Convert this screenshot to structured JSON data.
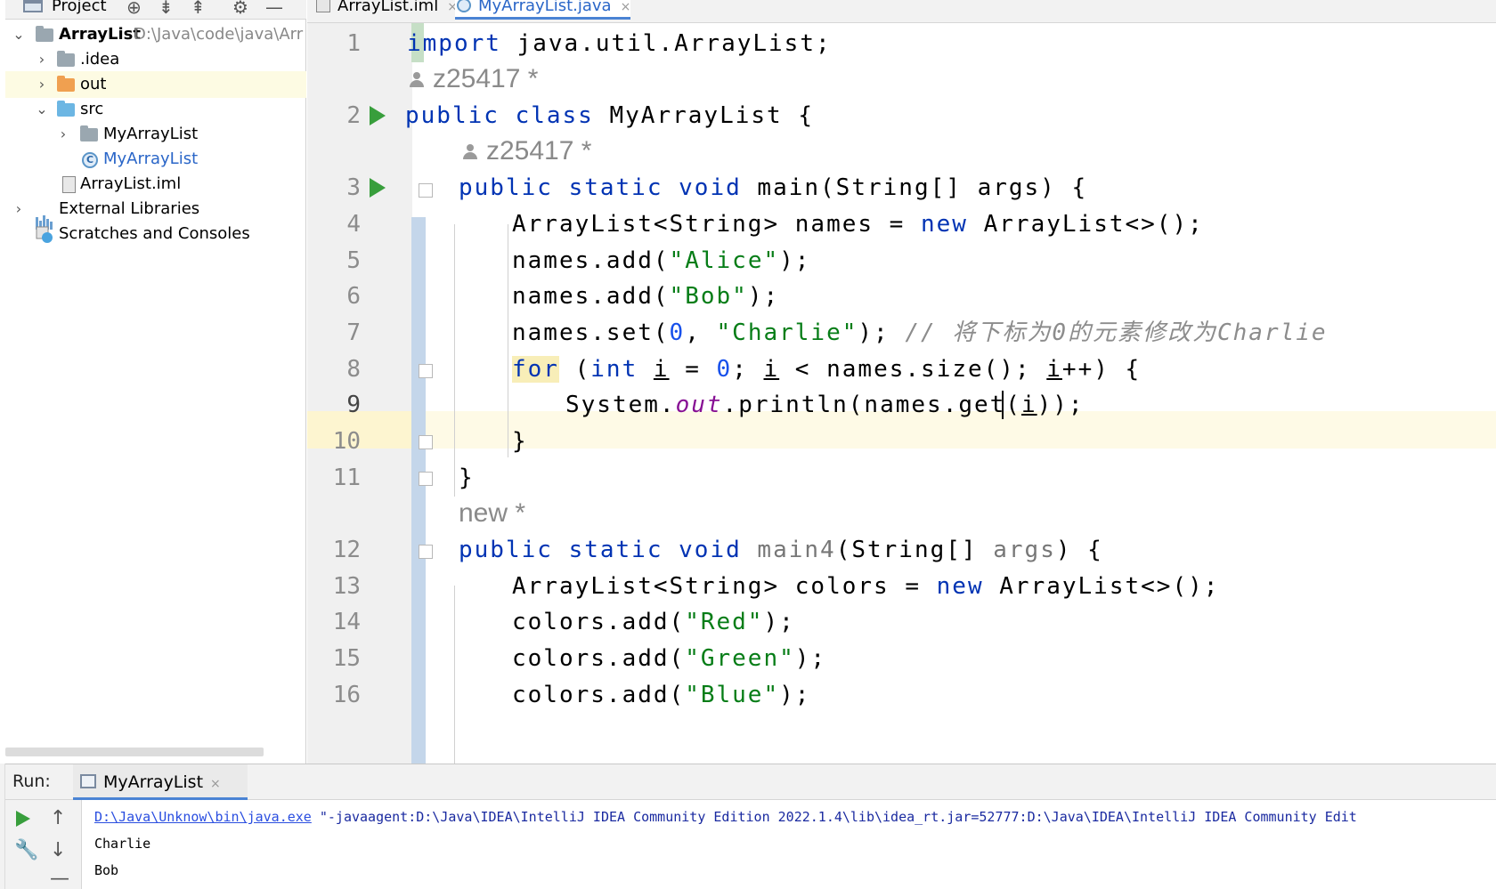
{
  "project_panel": {
    "title": "Project",
    "tree": [
      {
        "label": "ArrayList",
        "path": "D:\\Java\\code\\java\\Arr"
      },
      {
        "label": ".idea"
      },
      {
        "label": "out"
      },
      {
        "label": "src"
      },
      {
        "label": "MyArrayList"
      },
      {
        "label": "MyArrayList"
      },
      {
        "label": "ArrayList.iml"
      },
      {
        "label": "External Libraries"
      },
      {
        "label": "Scratches and Consoles"
      }
    ]
  },
  "tabs": [
    {
      "label": "ArrayList.iml",
      "close": "×"
    },
    {
      "label": "MyArrayList.java",
      "close": "×"
    }
  ],
  "editor": {
    "line_numbers": [
      "1",
      "2",
      "3",
      "4",
      "5",
      "6",
      "7",
      "8",
      "9",
      "10",
      "11",
      "12",
      "13",
      "14",
      "15",
      "16"
    ],
    "author_1": "z25417 *",
    "author_2": "z25417 *",
    "author_3": "new *",
    "l1": {
      "kw": "import",
      "rest": " java.util.ArrayList;"
    },
    "l2": {
      "kw": "public class",
      "rest": " MyArrayList {"
    },
    "l3": {
      "kw": "public static void",
      "rest": " main(String[] args) {"
    },
    "l4": {
      "a": "ArrayList<String> names = ",
      "kw": "new",
      "b": " ArrayList<>();"
    },
    "l5": {
      "a": "names.add(",
      "s": "\"Alice\"",
      "b": ");"
    },
    "l6": {
      "a": "names.add(",
      "s": "\"Bob\"",
      "b": ");"
    },
    "l7": {
      "a": "names.set(",
      "n": "0",
      "c": ", ",
      "s": "\"Charlie\"",
      "b": "); ",
      "cmt": "// 将下标为0的元素修改为Charlie"
    },
    "l8": {
      "kw": "for",
      "a": " (",
      "kw2": "int",
      "b": " ",
      "i1": "i",
      "c": " = ",
      "n": "0",
      "d": "; ",
      "i2": "i",
      "e": " < names.size(); ",
      "i3": "i",
      "f": "++) {"
    },
    "l9": {
      "a": "System.",
      "field": "out",
      "b": ".println(names.get(",
      "i": "i",
      "c": "));"
    },
    "l10": "}",
    "l11": "}",
    "l12": {
      "kw": "public static void",
      "name": " main4",
      "a": "(String[] ",
      "arg": "args",
      "b": ") {"
    },
    "l13": {
      "a": "ArrayList<String> colors = ",
      "kw": "new",
      "b": " ArrayList<>();"
    },
    "l14": {
      "a": "colors.add(",
      "s": "\"Red\"",
      "b": ");"
    },
    "l15": {
      "a": "colors.add(",
      "s": "\"Green\"",
      "b": ");"
    },
    "l16": {
      "a": "colors.add(",
      "s": "\"Blue\"",
      "b": ");"
    }
  },
  "run_panel": {
    "label": "Run:",
    "tab": "MyArrayList",
    "tab_close": "×",
    "cmd_link": "D:\\Java\\Unknow\\bin\\java.exe",
    "cmd_rest": " \"-javaagent:D:\\Java\\IDEA\\IntelliJ IDEA Community Edition 2022.1.4\\lib\\idea_rt.jar=52777:D:\\Java\\IDEA\\IntelliJ IDEA Community Edit",
    "output": [
      "Charlie",
      "Bob"
    ]
  },
  "colors": {
    "keyword": "#0033b3",
    "string": "#067d17",
    "number": "#1750eb",
    "comment": "#8c8c8c",
    "run_green": "#389e3c",
    "caret_line": "#fefae6"
  }
}
